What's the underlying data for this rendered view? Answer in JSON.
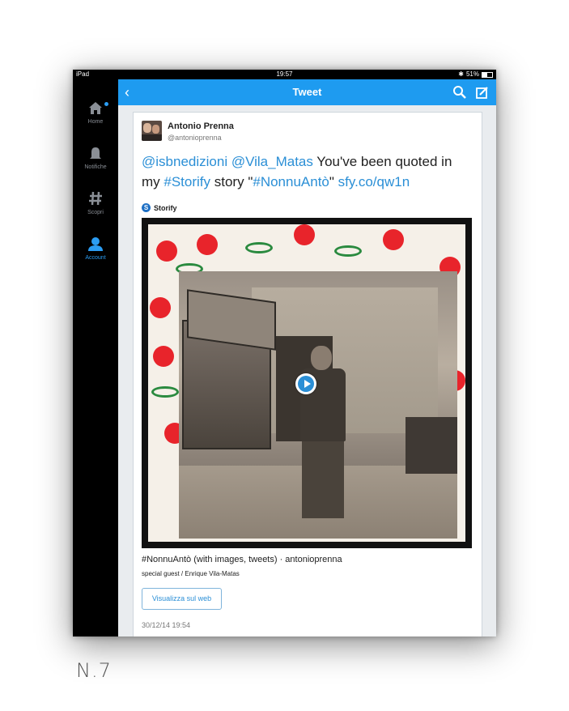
{
  "status_bar": {
    "device": "iPad",
    "time": "19:57",
    "battery": "51%",
    "battery_level": 0.51
  },
  "sidebar": {
    "items": [
      {
        "label": "Home",
        "icon": "home-icon"
      },
      {
        "label": "Notifiche",
        "icon": "bell-icon"
      },
      {
        "label": "Scopri",
        "icon": "hashtag-icon"
      },
      {
        "label": "Account",
        "icon": "person-icon",
        "active": true
      }
    ]
  },
  "navbar": {
    "title": "Tweet"
  },
  "tweet": {
    "author_name": "Antonio Prenna",
    "author_handle": "@antonioprenna",
    "text_parts": {
      "mention1": "@isbnedizioni",
      "mention2": "@Vila_Matas",
      "plain1": " You've been quoted in my ",
      "hashtag1": "#Storify",
      "plain2": " story \"",
      "hashtag2": "#NonnuAntò",
      "plain3": "\" ",
      "url": "sfy.co/qw1n"
    },
    "card_provider": "Storify",
    "story_title": "#NonnuAntò (with images, tweets) · antonioprenna",
    "story_subtitle": "special guest / Enrique Vila-Matas",
    "web_button": "Visualizza sul web",
    "timestamp": "30/12/14 19:54"
  },
  "caption": "N.7",
  "colors": {
    "accent": "#1e9bf0",
    "link": "#2b8fd6"
  }
}
